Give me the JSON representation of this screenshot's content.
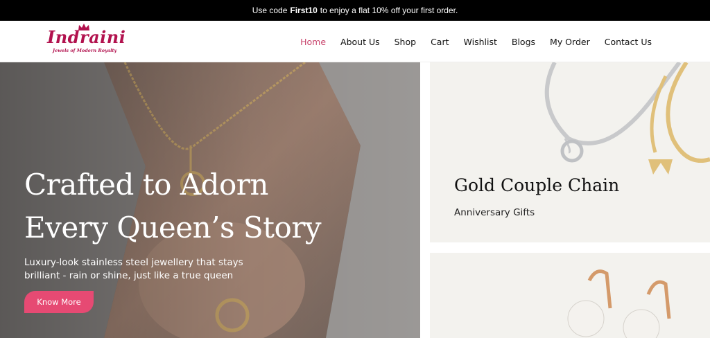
{
  "announcement": {
    "prefix": "Use code",
    "code": "First10",
    "suffix": "to enjoy a flat 10% off your first order."
  },
  "brand": {
    "name": "Indraini",
    "tagline": "Jewels of Modern Royalty",
    "color": "#b2124e"
  },
  "nav": {
    "items": [
      {
        "label": "Home",
        "active": true
      },
      {
        "label": "About Us"
      },
      {
        "label": "Shop"
      },
      {
        "label": "Cart"
      },
      {
        "label": "Wishlist"
      },
      {
        "label": "Blogs"
      },
      {
        "label": "My Order"
      },
      {
        "label": "Contact Us"
      }
    ],
    "active_color": "#c9456d"
  },
  "hero": {
    "title_line1": "Crafted to Adorn",
    "title_line2": "Every Queen’s Story",
    "subtitle": "Luxury-look stainless steel jewellery that stays brilliant - rain or shine, just like a true queen",
    "cta": "Know More",
    "cta_color": "#e64a73"
  },
  "cards": [
    {
      "title": "Gold Couple Chain",
      "subtitle": "Anniversary Gifts",
      "image": "chain-pendant-image"
    },
    {
      "image": "pearl-earrings-image"
    }
  ]
}
